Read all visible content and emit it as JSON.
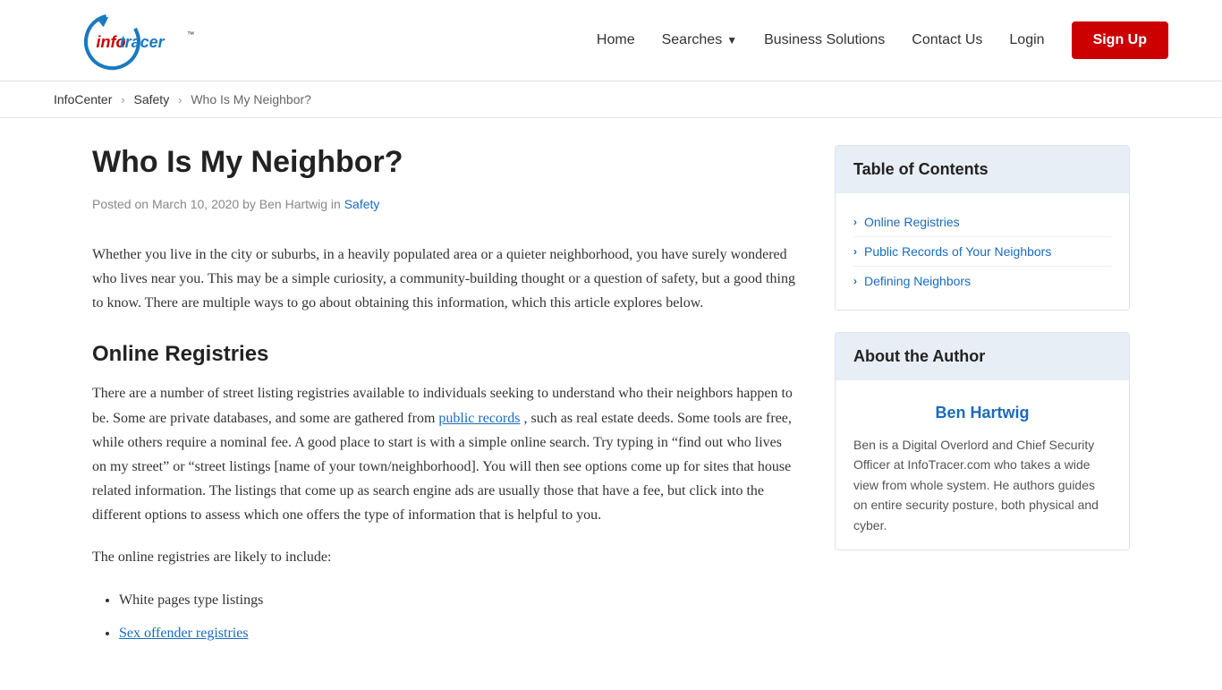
{
  "header": {
    "logo_alt": "InfoTracer",
    "nav": {
      "home": "Home",
      "searches": "Searches",
      "business_solutions": "Business Solutions",
      "contact_us": "Contact Us",
      "login": "Login",
      "signup": "Sign Up"
    }
  },
  "breadcrumb": {
    "infocenter": "InfoCenter",
    "safety": "Safety",
    "current": "Who Is My Neighbor?"
  },
  "article": {
    "title": "Who Is My Neighbor?",
    "meta": "Posted on March 10, 2020 by Ben Hartwig in",
    "meta_category": "Safety",
    "intro": "Whether you live in the city or suburbs, in a heavily populated area or a quieter neighborhood, you have surely wondered who lives near you. This may be a simple curiosity, a community-building thought or a question of safety, but a good thing to know. There are multiple ways to go about obtaining this information, which this article explores below.",
    "section1_title": "Online Registries",
    "section1_p1": "There are a number of street listing registries available to individuals seeking to understand who their neighbors happen to be. Some are private databases, and some are gathered from",
    "section1_p1_link": "public records",
    "section1_p1_cont": ", such as real estate deeds. Some tools are free, while others require a nominal fee. A good place to start is with a simple online search. Try typing in “find out who lives on my street” or “street listings [name of your town/neighborhood]. You will then see options come up for sites that house related information. The listings that come up as search engine ads are usually those that have a fee, but click into the different options to assess which one offers the type of information that is helpful to you.",
    "section1_p2": "The online registries are likely to include:",
    "list": [
      "White pages type listings",
      "Sex offender registries"
    ],
    "list_link_index": 1,
    "list_link_text": "Sex offender registries"
  },
  "sidebar": {
    "toc_title": "Table of Contents",
    "toc_items": [
      "Online Registries",
      "Public Records of Your Neighbors",
      "Defining Neighbors"
    ],
    "author_title": "About the Author",
    "author_name": "Ben Hartwig",
    "author_bio": "Ben is a Digital Overlord and Chief Security Officer at InfoTracer.com who takes a wide view from whole system. He authors guides on entire security posture, both physical and cyber."
  },
  "colors": {
    "accent": "#cc0000",
    "link": "#1a6bbd",
    "toc_bg": "#e8eef5"
  }
}
